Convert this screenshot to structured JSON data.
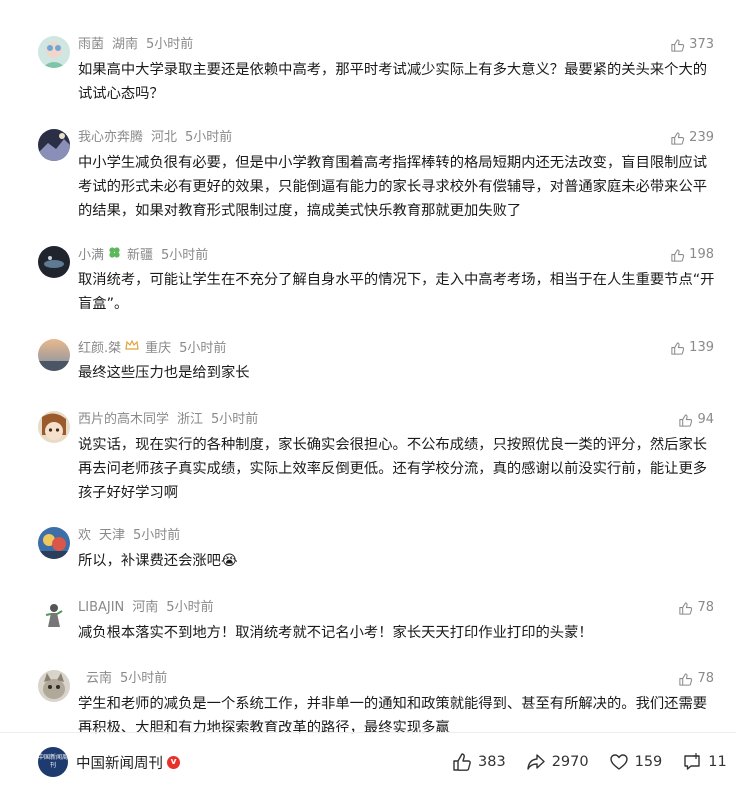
{
  "comments": [
    {
      "name": "雨菌",
      "location": "湖南",
      "time": "5小时前",
      "likes": "373",
      "text": "如果高中大学录取主要还是依赖中高考，那平时考试减少实际上有多大意义？最要紧的关头来个大的试试心态吗？"
    },
    {
      "name": "我心亦奔腾",
      "location": "河北",
      "time": "5小时前",
      "likes": "239",
      "text": "中小学生减负很有必要，但是中小学教育围着高考指挥棒转的格局短期内还无法改变，盲目限制应试考试的形式未必有更好的效果，只能倒逼有能力的家长寻求校外有偿辅导，对普通家庭未必带来公平的结果，如果对教育形式限制过度，搞成美式快乐教育那就更加失败了"
    },
    {
      "name": "小满",
      "location": "新疆",
      "time": "5小时前",
      "likes": "198",
      "text": "取消统考，可能让学生在不充分了解自身水平的情况下，走入中高考考场，相当于在人生重要节点“开盲盒”。"
    },
    {
      "name": "红颜.桀",
      "location": "重庆",
      "time": "5小时前",
      "likes": "139",
      "text": "最终这些压力也是给到家长"
    },
    {
      "name": "西片的高木同学",
      "location": "浙江",
      "time": "5小时前",
      "likes": "94",
      "text": "说实话，现在实行的各种制度，家长确实会很担心。不公布成绩，只按照优良一类的评分，然后家长再去问老师孩子真实成绩，实际上效率反倒更低。还有学校分流，真的感谢以前没实行前，能让更多孩子好好学习啊"
    },
    {
      "name": "欢",
      "location": "天津",
      "time": "5小时前",
      "likes": "",
      "text": "所以，补课费还会涨吧😭"
    },
    {
      "name": "LIBAJIN",
      "location": "河南",
      "time": "5小时前",
      "likes": "78",
      "text": "减负根本落实不到地方！取消统考就不记名小考！家长天天打印作业打印的头蒙！"
    },
    {
      "name": "",
      "location": "云南",
      "time": "5小时前",
      "likes": "78",
      "text": "学生和老师的减负是一个系统工作，并非单一的通知和政策就能得到、甚至有所解决的。我们还需要再积极、大胆和有力地探索教育改革的路径，最终实现多赢"
    }
  ],
  "footer": {
    "source_name": "中国新闻周刊",
    "logo_text": "中国新闻周刊",
    "likes": "383",
    "shares": "2970",
    "favorites": "159",
    "comments": "11"
  },
  "colors": {
    "meta": "#8a8a8a",
    "text": "#1a1a1a",
    "verified": "#e8312a",
    "logo_bg": "#1d3b6e"
  }
}
